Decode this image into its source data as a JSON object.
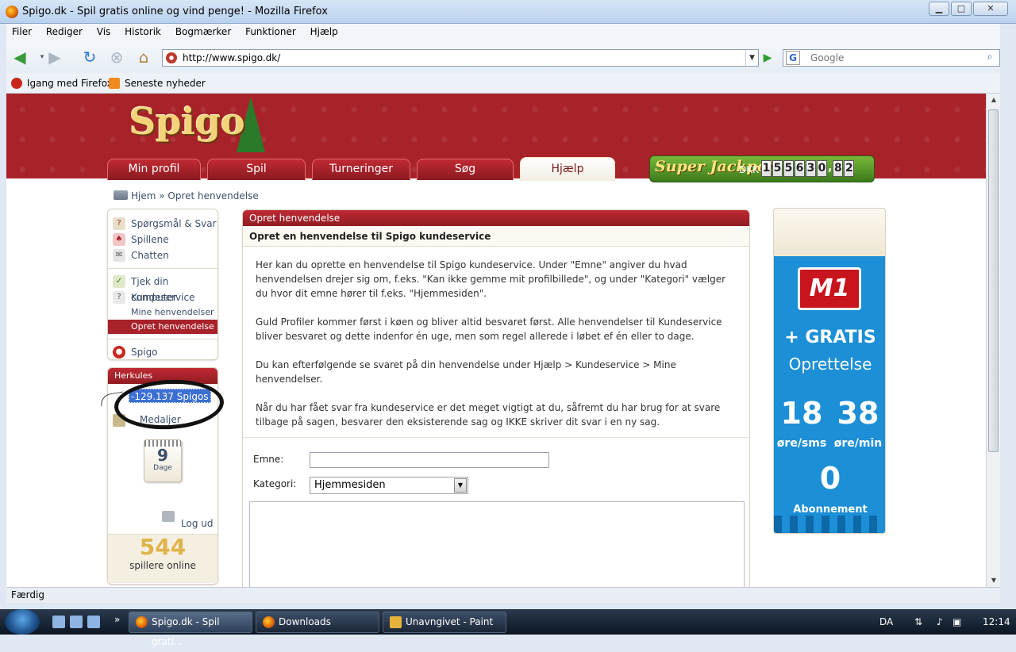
{
  "window": {
    "title": "Spigo.dk - Spil gratis online og vind penge! - Mozilla Firefox"
  },
  "menu": [
    "Filer",
    "Rediger",
    "Vis",
    "Historik",
    "Bogmærker",
    "Funktioner",
    "Hjælp"
  ],
  "address": {
    "url": "http://www.spigo.dk/"
  },
  "search": {
    "placeholder": "Google"
  },
  "bookmarks": [
    "Igang med Firefox",
    "Seneste nyheder"
  ],
  "site": {
    "tabs": [
      "Min profil",
      "Spil",
      "Turneringer",
      "Søg",
      "Hjælp"
    ],
    "active_tab": "Hjælp",
    "jackpot": {
      "logo": "Super Jackpot!",
      "currency": "DKK",
      "digits": [
        "1",
        "5",
        "5",
        "6",
        "3",
        "0",
        ",",
        "8",
        "2"
      ]
    }
  },
  "breadcrumb": {
    "home": "Hjem",
    "sep": " » ",
    "current": "Opret henvendelse"
  },
  "sidebar": {
    "group1": [
      "Spørgsmål & Svar",
      "Spillene",
      "Chatten"
    ],
    "group2": [
      "Tjek din computer",
      "Kundeservice"
    ],
    "sub": [
      "Mine henvendelser",
      "Opret henvendelse"
    ],
    "group3": [
      "Spigo"
    ],
    "user_box_title": "Herkules",
    "balance": "-129.137 Spigos",
    "medaljer": "Medaljer",
    "days_num": "9",
    "days_label": "Dage",
    "logout": "Log ud",
    "online_count": "544",
    "online_label": "spillere online"
  },
  "panel": {
    "header": "Opret henvendelse",
    "subheader": "Opret en henvendelse til Spigo kundeservice",
    "paragraphs": [
      "Her kan du oprette en henvendelse til Spigo kundeservice. Under \"Emne\" angiver du hvad henvendelsen drejer sig om, f.eks. \"Kan ikke gemme mit profilbillede\", og under \"Kategori\" vælger du hvor dit emne hører til f.eks. \"Hjemmesiden\".",
      "Guld Profiler kommer først i køen og bliver altid besvaret først. Alle henvendelser til Kundeservice bliver besvaret og dette indenfor én uge, men som regel allerede i løbet ef én eller to dage.",
      "Du kan efterfølgende se svaret på din henvendelse under Hjælp > Kundeservice > Mine henvendelser.",
      "Når du har fået svar fra kundeservice er det meget vigtigt at du, såfremt du har brug for at svare tilbage på sagen, besvarer den eksisterende sag og IKKE skriver dit svar i en ny sag."
    ],
    "emne_label": "Emne:",
    "kategori_label": "Kategori:",
    "kategori_value": "Hjemmesiden"
  },
  "ad": {
    "brand": "M1",
    "line1": "+ GRATIS",
    "line2": "Oprettelse",
    "price1": "18",
    "unit1": "øre/sms",
    "price2": "38",
    "unit2": "øre/min",
    "price3": "0",
    "unit3": "Abonnement"
  },
  "status": {
    "text": "Færdig"
  },
  "taskbar": {
    "tasks": [
      "Spigo.dk - Spil grati...",
      "Downloads",
      "Unavngivet - Paint"
    ],
    "lang": "DA",
    "time": "12:14"
  },
  "colors": {
    "brand_red": "#a8222a",
    "jackpot_green": "#3b7a1c",
    "ad_blue": "#1c8fd6"
  }
}
